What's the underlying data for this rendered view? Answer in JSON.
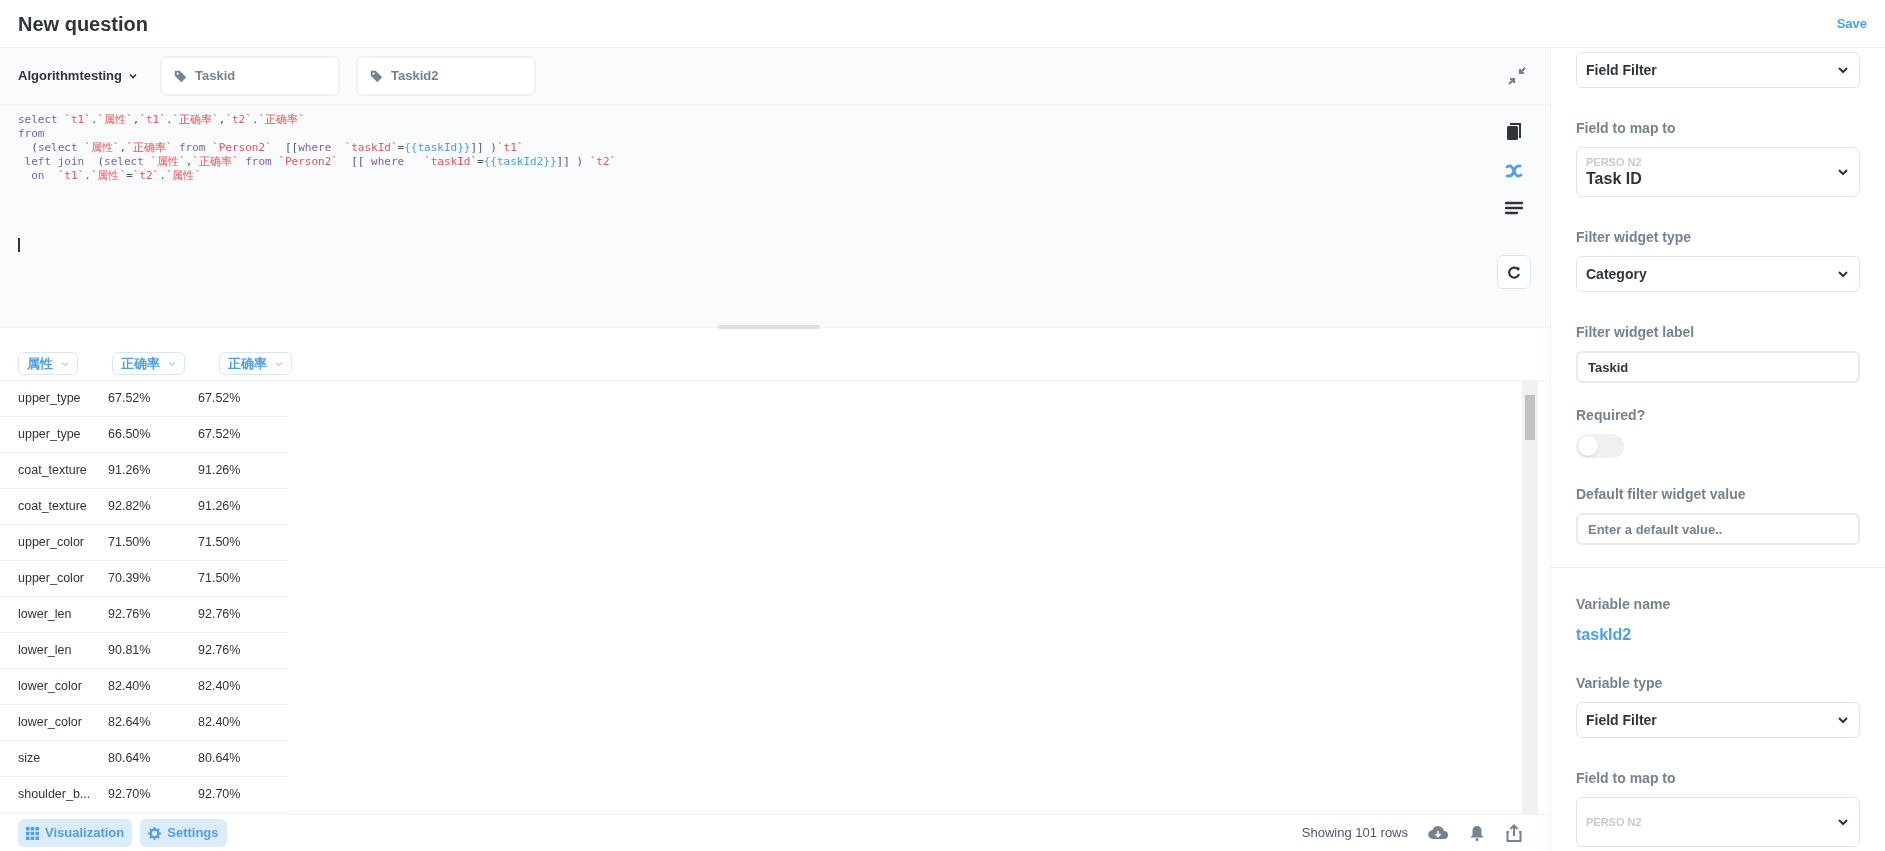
{
  "header": {
    "title": "New question",
    "save": "Save"
  },
  "toolbar": {
    "database": "Algorithmtesting",
    "variables": [
      "Taskid",
      "Taskid2"
    ]
  },
  "editor": {
    "lines": [
      [
        {
          "kind": "keyword",
          "text": "select"
        },
        {
          "kind": "string",
          "text": " `t1`"
        },
        {
          "kind": "plain",
          "text": "."
        },
        {
          "kind": "string",
          "text": "`属性`"
        },
        {
          "kind": "plain",
          "text": ","
        },
        {
          "kind": "string",
          "text": "`t1`"
        },
        {
          "kind": "plain",
          "text": "."
        },
        {
          "kind": "string",
          "text": "`正确率`"
        },
        {
          "kind": "plain",
          "text": ","
        },
        {
          "kind": "string",
          "text": "`t2`"
        },
        {
          "kind": "plain",
          "text": "."
        },
        {
          "kind": "string",
          "text": "`正确率`"
        }
      ],
      [
        {
          "kind": "keyword",
          "text": "from"
        }
      ],
      [
        {
          "kind": "plain",
          "text": "  ("
        },
        {
          "kind": "keyword",
          "text": "select"
        },
        {
          "kind": "string",
          "text": " `属性`"
        },
        {
          "kind": "plain",
          "text": ","
        },
        {
          "kind": "string",
          "text": "`正确率`"
        },
        {
          "kind": "keyword",
          "text": " from"
        },
        {
          "kind": "string",
          "text": " `Person2`"
        },
        {
          "kind": "plain",
          "text": "  [["
        },
        {
          "kind": "keyword",
          "text": "where"
        },
        {
          "kind": "string",
          "text": "  `taskId`"
        },
        {
          "kind": "plain",
          "text": "="
        },
        {
          "kind": "variable",
          "text": "{{taskId}}"
        },
        {
          "kind": "plain",
          "text": "]] )"
        },
        {
          "kind": "string",
          "text": "`t1`"
        }
      ],
      [
        {
          "kind": "keyword",
          "text": " left join"
        },
        {
          "kind": "plain",
          "text": "  ("
        },
        {
          "kind": "keyword",
          "text": "select"
        },
        {
          "kind": "string",
          "text": " `属性`"
        },
        {
          "kind": "plain",
          "text": ","
        },
        {
          "kind": "string",
          "text": "`正确率`"
        },
        {
          "kind": "keyword",
          "text": " from"
        },
        {
          "kind": "string",
          "text": " `Person2`"
        },
        {
          "kind": "plain",
          "text": "  [[ "
        },
        {
          "kind": "keyword",
          "text": "where"
        },
        {
          "kind": "string",
          "text": "   `taskId`"
        },
        {
          "kind": "plain",
          "text": "="
        },
        {
          "kind": "variable",
          "text": "{{taskId2}}"
        },
        {
          "kind": "plain",
          "text": "]] ) "
        },
        {
          "kind": "string",
          "text": "`t2`"
        }
      ],
      [
        {
          "kind": "keyword",
          "text": "  on"
        },
        {
          "kind": "string",
          "text": "  `t1`"
        },
        {
          "kind": "plain",
          "text": "."
        },
        {
          "kind": "string",
          "text": "`属性`"
        },
        {
          "kind": "plain",
          "text": "="
        },
        {
          "kind": "string",
          "text": "`t2`"
        },
        {
          "kind": "plain",
          "text": "."
        },
        {
          "kind": "string",
          "text": "`属性`"
        }
      ]
    ]
  },
  "table": {
    "columns": [
      "属性",
      "正确率",
      "正确率"
    ],
    "rows": [
      [
        "upper_type",
        "67.52%",
        "67.52%"
      ],
      [
        "upper_type",
        "66.50%",
        "67.52%"
      ],
      [
        "coat_texture",
        "91.26%",
        "91.26%"
      ],
      [
        "coat_texture",
        "92.82%",
        "91.26%"
      ],
      [
        "upper_color",
        "71.50%",
        "71.50%"
      ],
      [
        "upper_color",
        "70.39%",
        "71.50%"
      ],
      [
        "lower_len",
        "92.76%",
        "92.76%"
      ],
      [
        "lower_len",
        "90.81%",
        "92.76%"
      ],
      [
        "lower_color",
        "82.40%",
        "82.40%"
      ],
      [
        "lower_color",
        "82.64%",
        "82.40%"
      ],
      [
        "size",
        "80.64%",
        "80.64%"
      ],
      [
        "shoulder_b...",
        "92.70%",
        "92.70%"
      ]
    ]
  },
  "footer": {
    "buttons": [
      "Visualization",
      "Settings"
    ],
    "row_count": "Showing 101 rows"
  },
  "panel": {
    "fields": [
      {
        "kind": "select",
        "value": "Field Filter"
      },
      {
        "kind": "mapped_select",
        "label": "Field to map to",
        "table": "PERSO N2",
        "value": "Task ID"
      },
      {
        "kind": "select",
        "label": "Filter widget type",
        "value": "Category"
      },
      {
        "kind": "input",
        "label": "Filter widget label",
        "value": "Taskid"
      },
      {
        "kind": "toggle",
        "label": "Required?",
        "on": false
      },
      {
        "kind": "input",
        "label": "Default filter widget value",
        "placeholder": "Enter a default value.."
      },
      {
        "kind": "divider"
      },
      {
        "kind": "name",
        "label": "Variable name",
        "value": "taskId2"
      },
      {
        "kind": "select",
        "label": "Variable type",
        "value": "Field Filter"
      },
      {
        "kind": "mapped_select",
        "label": "Field to map to",
        "table": "PERSO N2"
      }
    ]
  }
}
